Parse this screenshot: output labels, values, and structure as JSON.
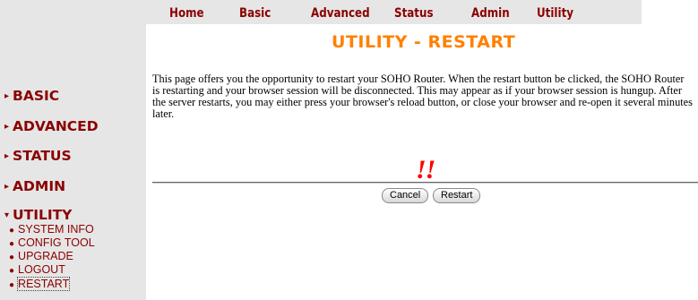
{
  "topnav": {
    "items": [
      {
        "label": "Home"
      },
      {
        "label": "Basic"
      },
      {
        "label": "Advanced"
      },
      {
        "label": "Status"
      },
      {
        "label": "Admin"
      },
      {
        "label": "Utility"
      }
    ]
  },
  "sidebar": {
    "sections": [
      {
        "label": "BASIC",
        "marker": "▸"
      },
      {
        "label": "ADVANCED",
        "marker": "▸"
      },
      {
        "label": "STATUS",
        "marker": "▸"
      },
      {
        "label": "ADMIN",
        "marker": "▸"
      },
      {
        "label": "UTILITY",
        "marker": "▾"
      }
    ],
    "utility_items": [
      {
        "label": "SYSTEM INFO"
      },
      {
        "label": "CONFIG TOOL"
      },
      {
        "label": "UPGRADE"
      },
      {
        "label": "LOGOUT"
      },
      {
        "label": "RESTART"
      }
    ]
  },
  "main": {
    "title": "UTILITY - RESTART",
    "description": "This page offers you the opportunity to restart your SOHO Router. When the restart button be clicked, the SOHO Router is restarting and your browser session will be disconnected. This may appear as if your browser session is hungup. After the server restarts, you may either press your browser's reload button, or close your browser and re-open it several minutes later.",
    "warning_mark": "!!",
    "cancel_label": "Cancel",
    "restart_label": "Restart"
  },
  "colors": {
    "nav_text": "#8b0000",
    "title": "#ff8000",
    "warning": "#ff0000",
    "sidebar_bg": "#e6e6e6"
  }
}
